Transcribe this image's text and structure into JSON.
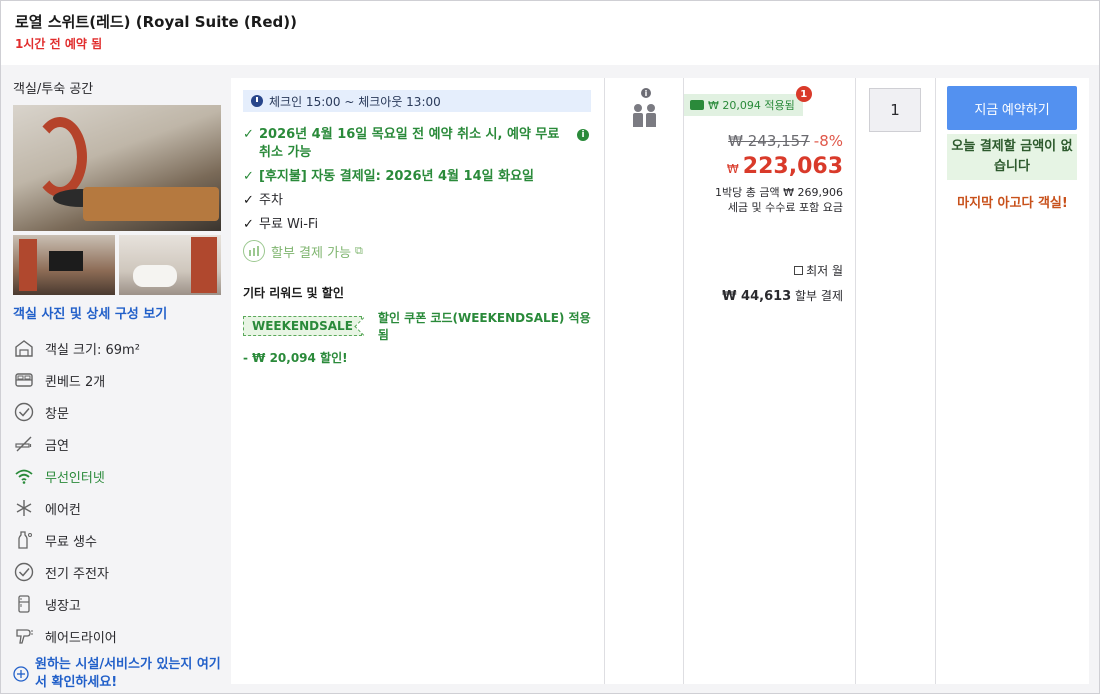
{
  "header": {
    "title": "로열 스위트(레드) (Royal Suite (Red))",
    "booked_notice": "1시간 전 예약 됨"
  },
  "room": {
    "space_label": "객실/투숙 공간",
    "view_details_link": "객실 사진 및 상세 구성 보기",
    "amenities": [
      {
        "icon": "house-icon",
        "label": "객실 크기: 69m²"
      },
      {
        "icon": "bed-icon",
        "label": "퀸베드 2개"
      },
      {
        "icon": "window-check-icon",
        "label": "창문"
      },
      {
        "icon": "no-smoking-icon",
        "label": "금연"
      },
      {
        "icon": "wifi-icon",
        "label": "무선인터넷",
        "color": "#2a8a3a"
      },
      {
        "icon": "snowflake-icon",
        "label": "에어컨"
      },
      {
        "icon": "water-bottle-icon",
        "label": "무료 생수"
      },
      {
        "icon": "kettle-check-icon",
        "label": "전기 주전자"
      },
      {
        "icon": "fridge-icon",
        "label": "냉장고"
      },
      {
        "icon": "hairdryer-icon",
        "label": "헤어드라이어"
      }
    ],
    "more_link": "원하는 시설/서비스가 있는지 여기서 확인하세요!"
  },
  "conditions": {
    "checkin_time": "체크인 15:00 ~ 체크아웃 13:00",
    "items": [
      {
        "text": "2026년 4월 16일 목요일 전 예약 취소 시, 예약 무료 취소 가능",
        "style": "green",
        "info": "i"
      },
      {
        "text": "[후지불] 자동 결제일: 2026년 4월 14일 화요일",
        "style": "green"
      },
      {
        "text": "주차",
        "style": "black"
      },
      {
        "text": "무료 Wi-Fi",
        "style": "black"
      }
    ],
    "installment": "할부 결제 가능",
    "rewards_title": "기타 리워드 및 할인",
    "coupon_code": "WEEKENDSALE",
    "coupon_desc": "할인 쿠폰 코드(WEEKENDSALE) 적용됨",
    "discount": "- ₩ 20,094 할인!"
  },
  "occupancy": {
    "info": "i"
  },
  "price": {
    "badge_text": "₩ 20,094 적용됨",
    "badge_count": "1",
    "original": "₩ 243,157",
    "discount_pct": "-8%",
    "currency": "₩",
    "final": "223,063",
    "per_night_line1": "1박당 총 금액 ₩ 269,906",
    "per_night_line2": "세금 및 수수료 포함 요금",
    "lowest_label": "최저 월",
    "installment_amount": "₩ 44,613",
    "installment_suffix": " 할부 결제"
  },
  "quantity": {
    "value": "1"
  },
  "booking": {
    "button_label": "지금 예약하기",
    "no_payment": "오늘 결제할 금액이 없습니다",
    "last_room": "마지막 아고다 객실!"
  },
  "colors": {
    "accent": "#5391f0",
    "green": "#2a8a3a",
    "red": "#d93a2a",
    "orange": "#c8511b"
  }
}
